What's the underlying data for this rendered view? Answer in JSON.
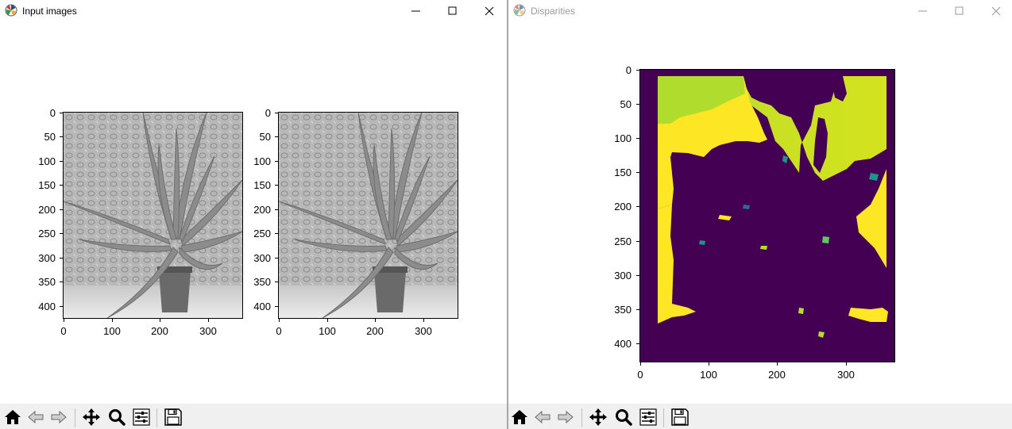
{
  "windows": {
    "left": {
      "title": "Input images",
      "active": true
    },
    "right": {
      "title": "Disparities",
      "active": false
    }
  },
  "toolbar": {
    "icons": [
      "home-icon",
      "back-arrow-icon",
      "forward-arrow-icon",
      "pan-icon",
      "zoom-icon",
      "configure-subplots-icon",
      "save-icon"
    ]
  },
  "plots": {
    "left_image": {
      "x_ticks": [
        "0",
        "100",
        "200",
        "300"
      ],
      "y_ticks": [
        "0",
        "50",
        "100",
        "150",
        "200",
        "250",
        "300",
        "350",
        "400"
      ]
    },
    "right_image": {
      "x_ticks": [
        "0",
        "100",
        "200",
        "300"
      ],
      "y_ticks": [
        "0",
        "50",
        "100",
        "150",
        "200",
        "250",
        "300",
        "350",
        "400"
      ]
    },
    "disparity_map": {
      "x_ticks": [
        "0",
        "100",
        "200",
        "300"
      ],
      "y_ticks": [
        "0",
        "50",
        "100",
        "150",
        "200",
        "250",
        "300",
        "350",
        "400"
      ],
      "colormap": "viridis"
    }
  },
  "colors": {
    "viridis_dark": "#440154",
    "viridis_yellow": "#fde725",
    "viridis_yellowgreen": "#b5de2b",
    "viridis_teal": "#21918c"
  }
}
